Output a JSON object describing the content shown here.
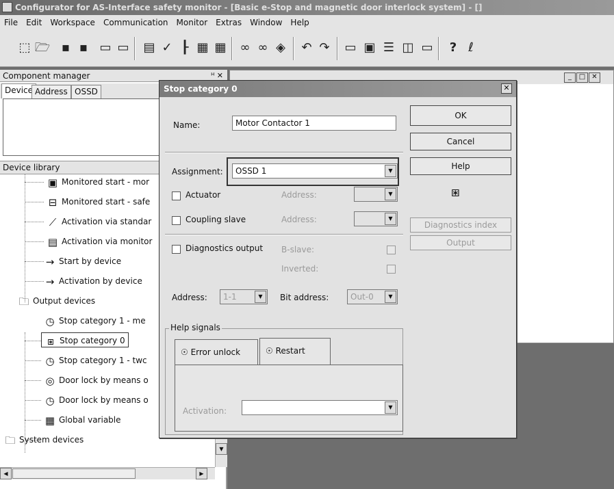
{
  "window": {
    "title": "Configurator for AS-Interface safety monitor - [Basic e-Stop and magnetic door interlock system] - []"
  },
  "menu": [
    "File",
    "Edit",
    "Workspace",
    "Communication",
    "Monitor",
    "Extras",
    "Window",
    "Help"
  ],
  "toolbar": {
    "icons": [
      "new-icon",
      "open-icon",
      "save-icon",
      "save-as-icon",
      "print-icon",
      "print-preview-icon",
      "insert-device-icon",
      "check-icon",
      "tree-icon",
      "document-icon",
      "document2-icon",
      "glasses-icon",
      "glasses2-icon",
      "diamond-icon",
      "undo-icon",
      "redo-icon",
      "window-icon",
      "cascade-icon",
      "tile-horizontal-icon",
      "tile-vertical-icon",
      "window2-icon",
      "help-icon",
      "context-help-icon"
    ]
  },
  "component_manager": {
    "title": "Component manager",
    "pin": "ᵸ ✕",
    "tabs": [
      "Device",
      "Address",
      "OSSD"
    ]
  },
  "device_library": {
    "title": "Device library",
    "items": [
      {
        "label": "Monitored start - mor",
        "icon": "monitored-start-icon"
      },
      {
        "label": "Monitored start - safe",
        "icon": "monitored-start-safe-icon"
      },
      {
        "label": "Activation via standar",
        "icon": "activation-switch-icon"
      },
      {
        "label": "Activation via monitor",
        "icon": "activation-monitor-icon"
      },
      {
        "label": "Start by device",
        "icon": "start-device-icon"
      },
      {
        "label": "Activation by device",
        "icon": "activation-device-icon"
      },
      {
        "label": "Output devices",
        "icon": "folder-icon"
      },
      {
        "label": "Stop category 1 - me",
        "icon": "stop-cat1-icon"
      },
      {
        "label": "Stop category 0",
        "icon": "contactor-icon"
      },
      {
        "label": "Stop category 1 - twc",
        "icon": "stop-cat1-two-icon"
      },
      {
        "label": "Door lock by means o",
        "icon": "door-lock-icon"
      },
      {
        "label": "Door lock by means o",
        "icon": "door-lock-timer-icon"
      },
      {
        "label": "Global variable",
        "icon": "global-variable-icon"
      },
      {
        "label": "System devices",
        "icon": "folder-icon"
      }
    ]
  },
  "dialog": {
    "title": "Stop category 0",
    "close": "✕",
    "name_label": "Name:",
    "name_value": "Motor Contactor 1",
    "assignment_label": "Assignment:",
    "assignment_value": "OSSD 1",
    "actuator_label": "Actuator",
    "coupling_label": "Coupling slave",
    "address_label1": "Address:",
    "address_label2": "Address:",
    "diag_label": "Diagnostics output",
    "bslave_label": "B-slave:",
    "inverted_label": "Inverted:",
    "address_label": "Address:",
    "address_value": "1-1",
    "bit_address_label": "Bit address:",
    "bit_address_value": "Out-0",
    "help_signals_label": "Help signals",
    "tab_error": "Error unlock",
    "tab_restart": "Restart",
    "activation_label": "Activation:",
    "buttons": {
      "ok": "OK",
      "cancel": "Cancel",
      "help": "Help",
      "diag_index": "Diagnostics index",
      "output": "Output"
    }
  }
}
